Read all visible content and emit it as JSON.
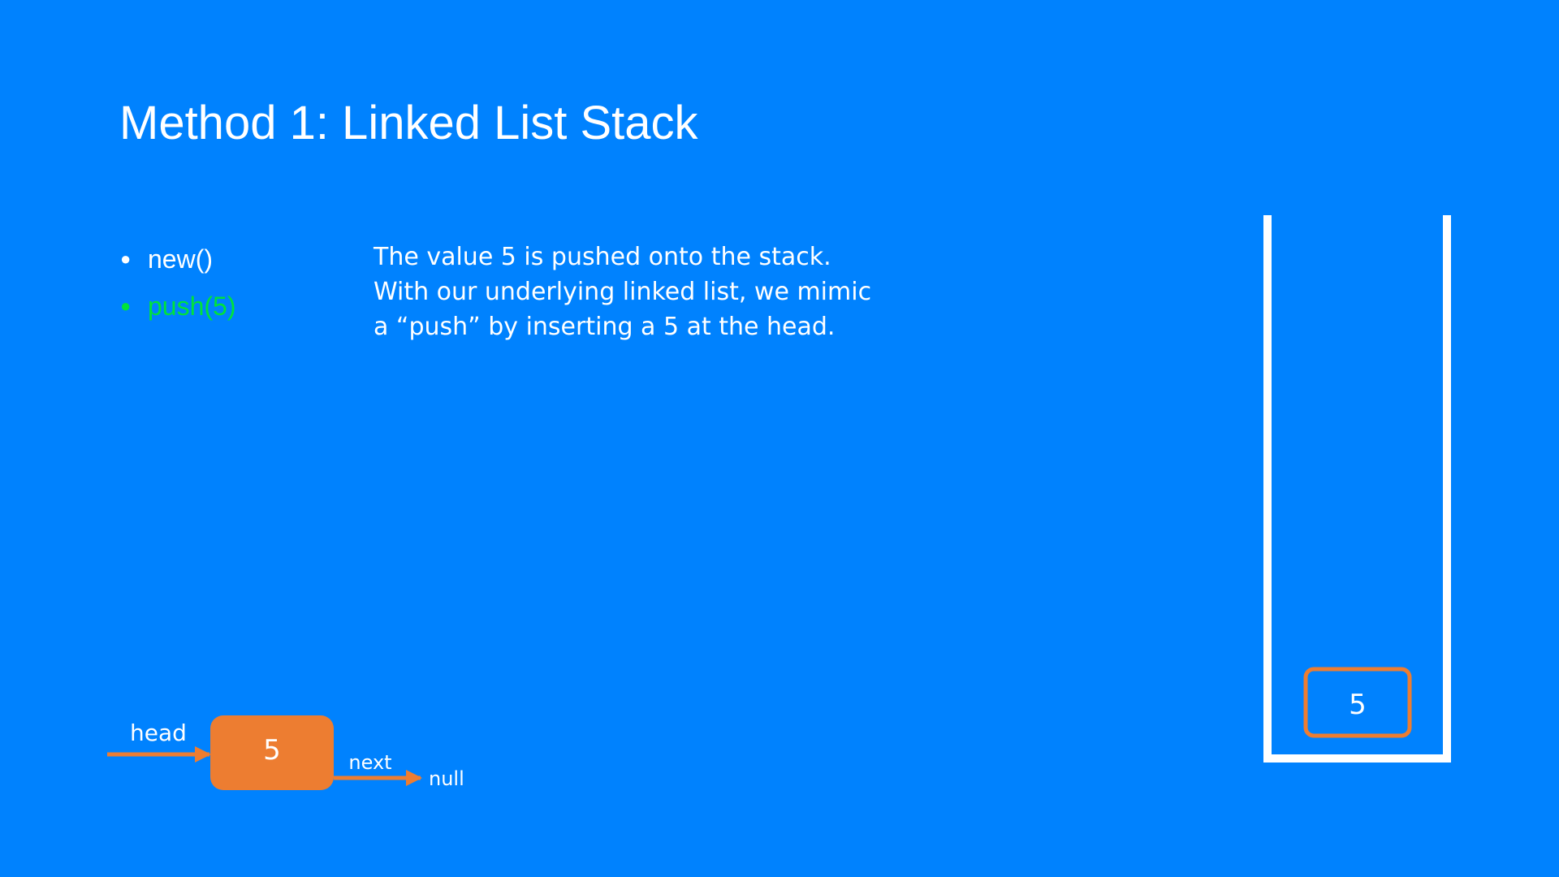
{
  "slide": {
    "title": "Method 1: Linked List Stack"
  },
  "operations": [
    {
      "label": "new()",
      "active": false
    },
    {
      "label": "push(5)",
      "active": true
    }
  ],
  "explanation": {
    "lines": [
      "The value 5 is pushed onto the stack.",
      "With our underlying linked list, we mimic",
      "a “push” by inserting a 5 at the head."
    ]
  },
  "linked_list": {
    "head_label": "head",
    "nodes": [
      {
        "value": "5",
        "next_label": "next"
      }
    ],
    "terminal_label": "null"
  },
  "stack": {
    "items": [
      "5"
    ]
  },
  "colors": {
    "background": "#0082fe",
    "accent_orange": "#ed7d31",
    "active_green": "#00e33a",
    "text": "#ffffff"
  }
}
